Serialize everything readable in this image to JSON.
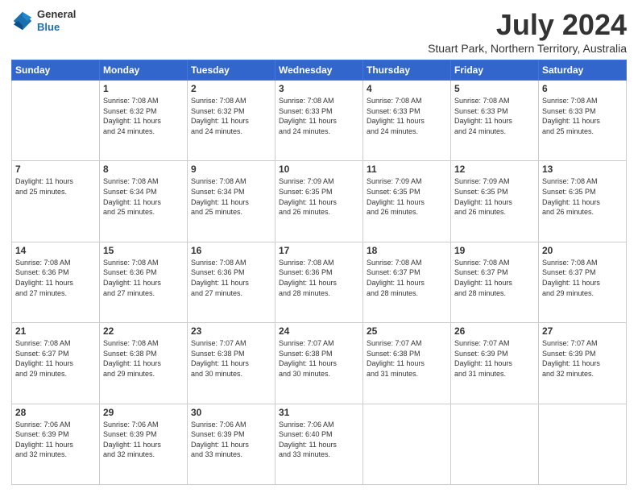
{
  "header": {
    "logo": {
      "general": "General",
      "blue": "Blue"
    },
    "title": "July 2024",
    "location": "Stuart Park, Northern Territory, Australia"
  },
  "weekdays": [
    "Sunday",
    "Monday",
    "Tuesday",
    "Wednesday",
    "Thursday",
    "Friday",
    "Saturday"
  ],
  "weeks": [
    [
      {
        "day": "",
        "info": ""
      },
      {
        "day": "1",
        "info": "Sunrise: 7:08 AM\nSunset: 6:32 PM\nDaylight: 11 hours\nand 24 minutes."
      },
      {
        "day": "2",
        "info": "Sunrise: 7:08 AM\nSunset: 6:32 PM\nDaylight: 11 hours\nand 24 minutes."
      },
      {
        "day": "3",
        "info": "Sunrise: 7:08 AM\nSunset: 6:33 PM\nDaylight: 11 hours\nand 24 minutes."
      },
      {
        "day": "4",
        "info": "Sunrise: 7:08 AM\nSunset: 6:33 PM\nDaylight: 11 hours\nand 24 minutes."
      },
      {
        "day": "5",
        "info": "Sunrise: 7:08 AM\nSunset: 6:33 PM\nDaylight: 11 hours\nand 24 minutes."
      },
      {
        "day": "6",
        "info": "Sunrise: 7:08 AM\nSunset: 6:33 PM\nDaylight: 11 hours\nand 25 minutes."
      }
    ],
    [
      {
        "day": "7",
        "info": "Daylight: 11 hours\nand 25 minutes."
      },
      {
        "day": "8",
        "info": "Sunrise: 7:08 AM\nSunset: 6:34 PM\nDaylight: 11 hours\nand 25 minutes."
      },
      {
        "day": "9",
        "info": "Sunrise: 7:08 AM\nSunset: 6:34 PM\nDaylight: 11 hours\nand 25 minutes."
      },
      {
        "day": "10",
        "info": "Sunrise: 7:09 AM\nSunset: 6:35 PM\nDaylight: 11 hours\nand 26 minutes."
      },
      {
        "day": "11",
        "info": "Sunrise: 7:09 AM\nSunset: 6:35 PM\nDaylight: 11 hours\nand 26 minutes."
      },
      {
        "day": "12",
        "info": "Sunrise: 7:09 AM\nSunset: 6:35 PM\nDaylight: 11 hours\nand 26 minutes."
      },
      {
        "day": "13",
        "info": "Sunrise: 7:08 AM\nSunset: 6:35 PM\nDaylight: 11 hours\nand 26 minutes."
      }
    ],
    [
      {
        "day": "14",
        "info": "Sunrise: 7:08 AM\nSunset: 6:36 PM\nDaylight: 11 hours\nand 27 minutes."
      },
      {
        "day": "15",
        "info": "Sunrise: 7:08 AM\nSunset: 6:36 PM\nDaylight: 11 hours\nand 27 minutes."
      },
      {
        "day": "16",
        "info": "Sunrise: 7:08 AM\nSunset: 6:36 PM\nDaylight: 11 hours\nand 27 minutes."
      },
      {
        "day": "17",
        "info": "Sunrise: 7:08 AM\nSunset: 6:36 PM\nDaylight: 11 hours\nand 28 minutes."
      },
      {
        "day": "18",
        "info": "Sunrise: 7:08 AM\nSunset: 6:37 PM\nDaylight: 11 hours\nand 28 minutes."
      },
      {
        "day": "19",
        "info": "Sunrise: 7:08 AM\nSunset: 6:37 PM\nDaylight: 11 hours\nand 28 minutes."
      },
      {
        "day": "20",
        "info": "Sunrise: 7:08 AM\nSunset: 6:37 PM\nDaylight: 11 hours\nand 29 minutes."
      }
    ],
    [
      {
        "day": "21",
        "info": "Sunrise: 7:08 AM\nSunset: 6:37 PM\nDaylight: 11 hours\nand 29 minutes."
      },
      {
        "day": "22",
        "info": "Sunrise: 7:08 AM\nSunset: 6:38 PM\nDaylight: 11 hours\nand 29 minutes."
      },
      {
        "day": "23",
        "info": "Sunrise: 7:07 AM\nSunset: 6:38 PM\nDaylight: 11 hours\nand 30 minutes."
      },
      {
        "day": "24",
        "info": "Sunrise: 7:07 AM\nSunset: 6:38 PM\nDaylight: 11 hours\nand 30 minutes."
      },
      {
        "day": "25",
        "info": "Sunrise: 7:07 AM\nSunset: 6:38 PM\nDaylight: 11 hours\nand 31 minutes."
      },
      {
        "day": "26",
        "info": "Sunrise: 7:07 AM\nSunset: 6:39 PM\nDaylight: 11 hours\nand 31 minutes."
      },
      {
        "day": "27",
        "info": "Sunrise: 7:07 AM\nSunset: 6:39 PM\nDaylight: 11 hours\nand 32 minutes."
      }
    ],
    [
      {
        "day": "28",
        "info": "Sunrise: 7:06 AM\nSunset: 6:39 PM\nDaylight: 11 hours\nand 32 minutes."
      },
      {
        "day": "29",
        "info": "Sunrise: 7:06 AM\nSunset: 6:39 PM\nDaylight: 11 hours\nand 32 minutes."
      },
      {
        "day": "30",
        "info": "Sunrise: 7:06 AM\nSunset: 6:39 PM\nDaylight: 11 hours\nand 33 minutes."
      },
      {
        "day": "31",
        "info": "Sunrise: 7:06 AM\nSunset: 6:40 PM\nDaylight: 11 hours\nand 33 minutes."
      },
      {
        "day": "",
        "info": ""
      },
      {
        "day": "",
        "info": ""
      },
      {
        "day": "",
        "info": ""
      }
    ]
  ]
}
